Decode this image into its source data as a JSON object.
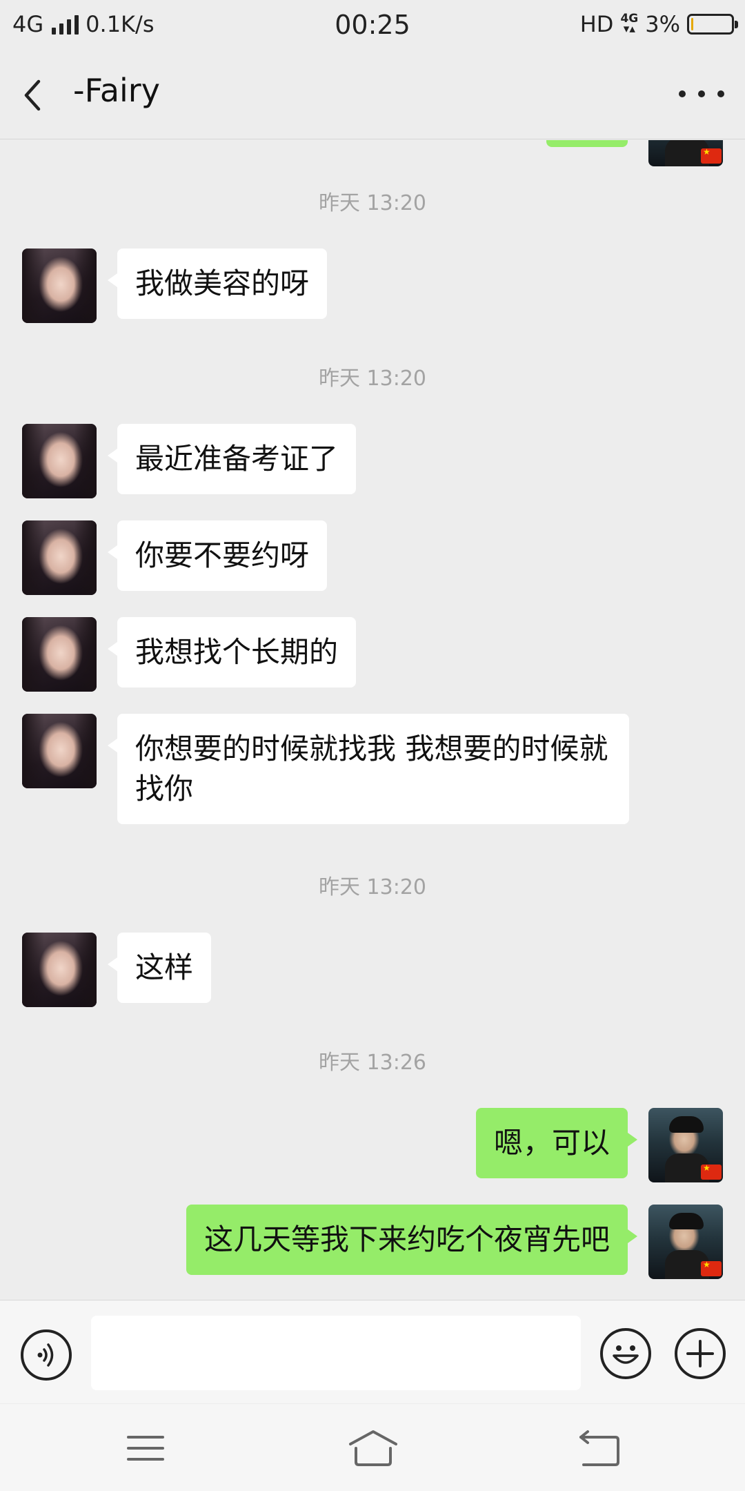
{
  "status_bar": {
    "network": "4G",
    "speed": "0.1K/s",
    "time": "00:25",
    "hd": "HD",
    "net_small": "4G",
    "battery_percent": "3%",
    "battery_level": 0.03
  },
  "header": {
    "back_icon": "chevron-left-icon",
    "title": "-Fairy",
    "more_icon": "more-dots-icon"
  },
  "chat": {
    "timestamps": [
      "昨天 13:20",
      "昨天 13:20",
      "昨天 13:20",
      "昨天 13:26"
    ],
    "messages": [
      {
        "text": "我做美容的呀"
      },
      {
        "text": "最近准备考证了"
      },
      {
        "text": "你要不要约呀"
      },
      {
        "text": "我想找个长期的"
      },
      {
        "text": "你想要的时候就找我 我想要的时候就找你"
      },
      {
        "text": "这样"
      },
      {
        "text": "嗯，可以"
      },
      {
        "text": "这几天等我下来约吃个夜宵先吧"
      }
    ]
  },
  "input_bar": {
    "voice_icon": "voice-icon",
    "input_value": "",
    "emoji_icon": "emoji-icon",
    "plus_icon": "plus-icon"
  },
  "system_nav": {
    "menu_icon": "menu-icon",
    "home_icon": "home-icon",
    "back_icon": "back-arrow-icon"
  },
  "colors": {
    "background": "#ededed",
    "bubble_in": "#ffffff",
    "bubble_out": "#95ec69",
    "timestamp": "#a3a3a3"
  }
}
